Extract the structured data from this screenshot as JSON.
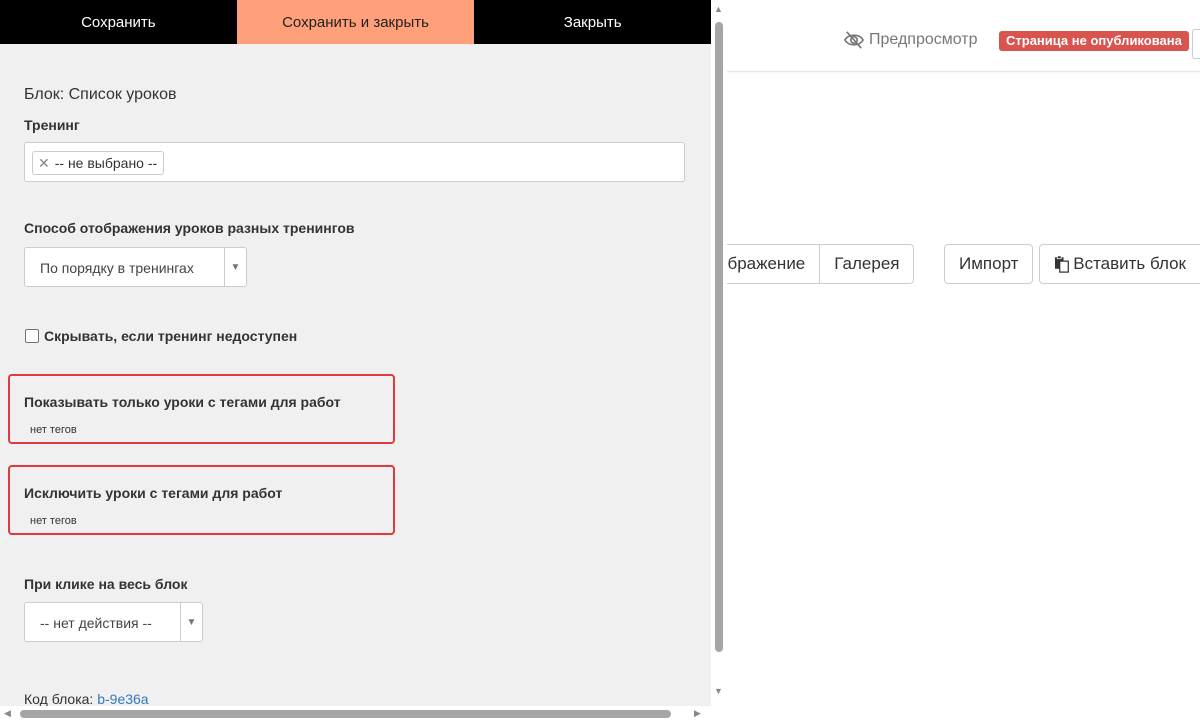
{
  "toolbar": {
    "save_label": "Сохранить",
    "save_close_label": "Сохранить и закрыть",
    "close_label": "Закрыть"
  },
  "panel": {
    "block_title": "Блок: Список уроков",
    "training_label": "Тренинг",
    "training_chip": "-- не выбрано --",
    "display_mode_label": "Способ отображения уроков разных тренингов",
    "display_mode_value": "По порядку в тренингах",
    "hide_checkbox_label": "Скрывать, если тренинг недоступен",
    "hide_checkbox_checked": false,
    "show_tags_label": "Показывать только уроки с тегами для работ",
    "show_tags_value": "нет тегов",
    "exclude_tags_label": "Исключить уроки с тегами для работ",
    "exclude_tags_value": "нет тегов",
    "click_label": "При клике на весь блок",
    "click_value": "-- нет действия --",
    "code_label": "Код блока:",
    "code_value": "b-9e36a"
  },
  "editor": {
    "preview_label": "Предпросмотр",
    "unpublished_badge": "Страница не опубликована",
    "display_button_partial": "ображение",
    "gallery_button": "Галерея",
    "import_button": "Импорт",
    "paste_block_button": "Вставить блок"
  },
  "colors": {
    "save_close_bg": "#ffa07a",
    "toolbar_bg": "#000000",
    "panel_bg": "#f0f0f0",
    "highlight_border": "#e0393e",
    "badge_red": "#d9534f",
    "link": "#337ab7"
  },
  "icons": {
    "preview": "eye-slash-icon",
    "paste": "clipboard-icon",
    "chip_remove": "close-icon"
  }
}
